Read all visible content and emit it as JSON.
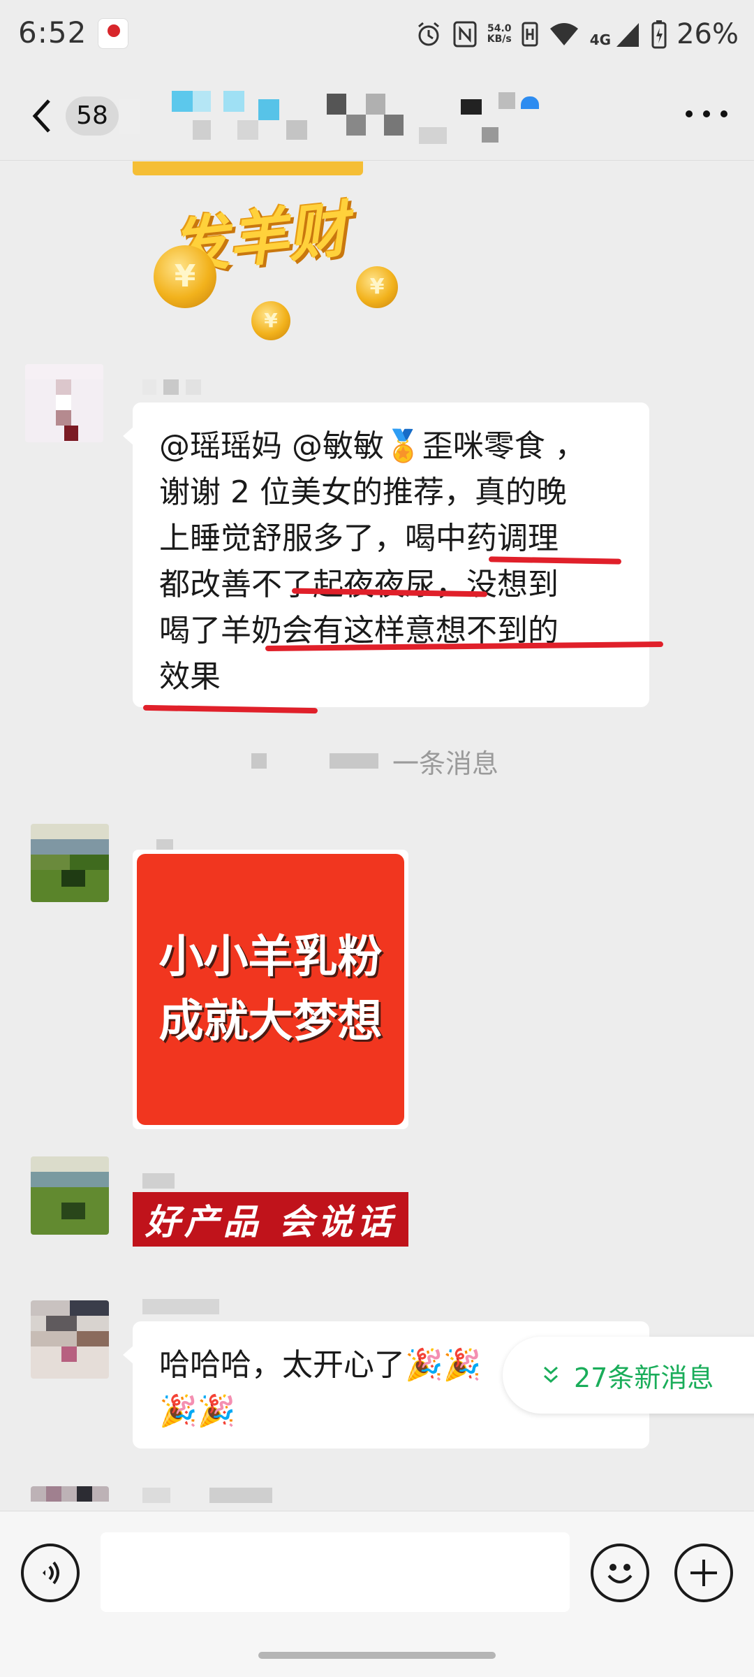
{
  "status_bar": {
    "time": "6:52",
    "network_speed_value": "54.0",
    "network_speed_unit": "KB/s",
    "network_type": "4G",
    "battery": "26%"
  },
  "nav": {
    "unread_count": "58",
    "title": ""
  },
  "messages": {
    "sticker_text_line1": "发羊财",
    "text_message": "@瑶瑶妈 @敏敏🏅歪咪零食 ，\n谢谢 2 位美女的推荐，真的晚\n上睡觉舒服多了，喝中药调理\n都改善不了起夜夜尿，没想到\n喝了羊奶会有这样意想不到的\n效果",
    "recalled_notice": "一条消息",
    "image_card_line1": "小小羊乳粉",
    "image_card_line2": "成就大梦想",
    "banner_text": "好产品 会说话",
    "party_message": "哈哈哈，太开心了",
    "new_messages": "27条新消息"
  },
  "colors": {
    "chat_bg": "#ededed",
    "bubble_bg": "#ffffff",
    "underline_red": "#e0202a",
    "new_msg_green": "#1aad5a",
    "image_card_red": "#f1361f"
  }
}
